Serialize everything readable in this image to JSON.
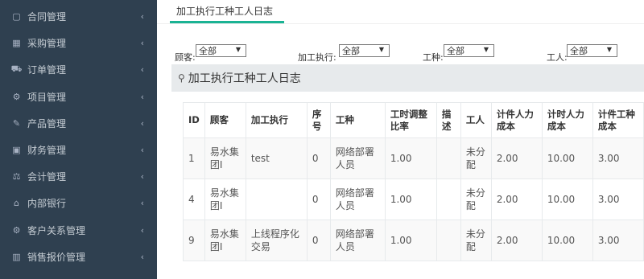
{
  "sidebar": {
    "items": [
      {
        "label": "合同管理",
        "icon": "contract-icon",
        "glyph": "▢"
      },
      {
        "label": "采购管理",
        "icon": "purchase-icon",
        "glyph": "▦"
      },
      {
        "label": "订单管理",
        "icon": "cart-icon",
        "glyph": "⛟"
      },
      {
        "label": "项目管理",
        "icon": "project-icon",
        "glyph": "⚙"
      },
      {
        "label": "产品管理",
        "icon": "product-icon",
        "glyph": "✎"
      },
      {
        "label": "财务管理",
        "icon": "finance-icon",
        "glyph": "▣"
      },
      {
        "label": "会计管理",
        "icon": "accounting-icon",
        "glyph": "⚖"
      },
      {
        "label": "内部银行",
        "icon": "bank-icon",
        "glyph": "⌂"
      },
      {
        "label": "客户关系管理",
        "icon": "crm-icon",
        "glyph": "⚙"
      },
      {
        "label": "销售报价管理",
        "icon": "sales-quote-icon",
        "glyph": "▥"
      }
    ]
  },
  "tab": {
    "label": "加工执行工种工人日志"
  },
  "filters": {
    "customer": {
      "label": "顾客:",
      "value": "全部"
    },
    "process": {
      "label": "加工执行:",
      "value": "全部"
    },
    "worktype": {
      "label": "工种:",
      "value": "全部"
    },
    "worker": {
      "label": "工人:",
      "value": "全部"
    }
  },
  "panel": {
    "title": "加工执行工种工人日志"
  },
  "table": {
    "headers": [
      "ID",
      "顾客",
      "加工执行",
      "序号",
      "工种",
      "工时调整比率",
      "描述",
      "工人",
      "计件人力成本",
      "计时人力成本",
      "计件工种成本"
    ],
    "rows": [
      [
        "1",
        "易水集团I",
        "test",
        "0",
        "网络部署人员",
        "1.00",
        "",
        "未分配",
        "2.00",
        "10.00",
        "3.00"
      ],
      [
        "4",
        "易水集团I",
        "",
        "0",
        "网络部署人员",
        "1.00",
        "",
        "未分配",
        "2.00",
        "10.00",
        "3.00"
      ],
      [
        "9",
        "易水集团I",
        "上线程序化交易",
        "0",
        "网络部署人员",
        "1.00",
        "",
        "未分配",
        "2.00",
        "10.00",
        "3.00"
      ]
    ]
  },
  "colors": {
    "sidebar_bg": "#2f4050",
    "accent": "#1ab394"
  }
}
